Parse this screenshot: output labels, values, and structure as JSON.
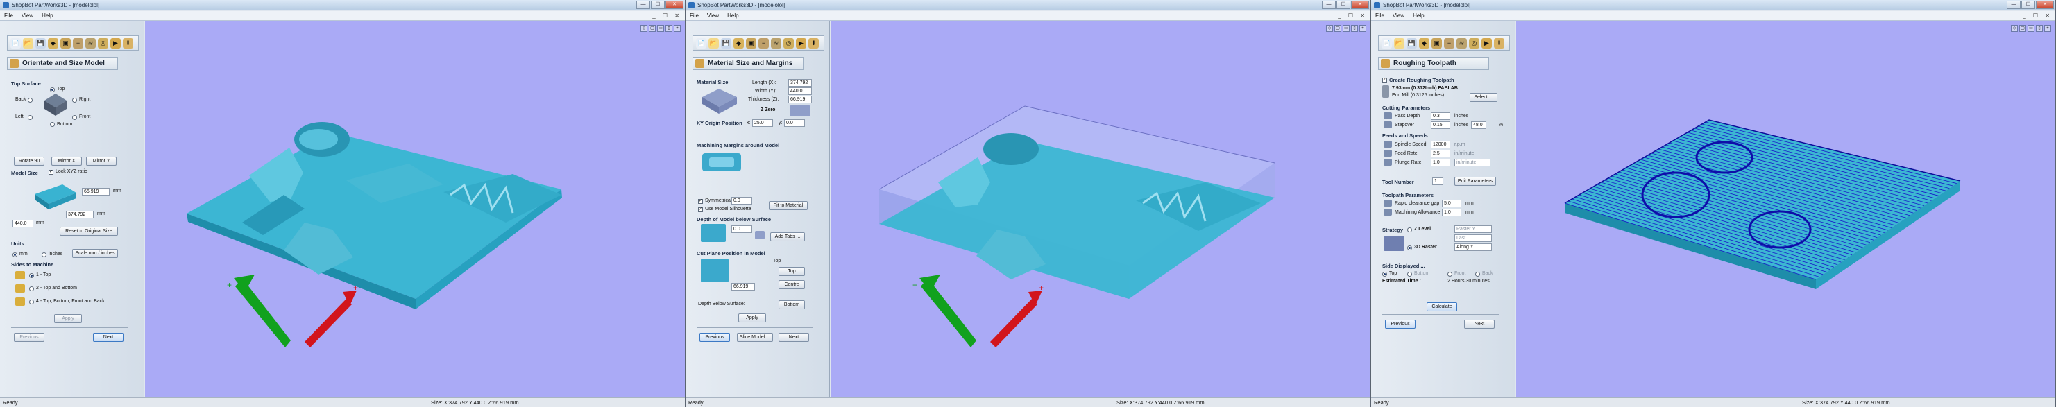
{
  "app_title": "ShopBot PartWorks3D - [modelolol]",
  "menu": [
    "File",
    "View",
    "Help"
  ],
  "status": {
    "ready": "Ready",
    "size": "Size: X:374.792 Y:440.0 Z:66.919 mm"
  },
  "colors": {
    "viewport_bg": "#aaaaf6",
    "model": "#39b3d1",
    "material_box": "#8fa0e3",
    "toolpath": "#1818c8",
    "x_arrow": "#d2151c",
    "y_arrow": "#11a11e"
  },
  "icons": [
    "new-icon",
    "open-icon",
    "save-icon",
    "orient-icon",
    "material-icon",
    "roughing-icon",
    "finishing-icon",
    "cutout-icon",
    "preview-icon",
    "save-toolpath-icon"
  ],
  "win1": {
    "panel_title": "Orientate and Size Model",
    "top_surface": {
      "header": "Top Surface",
      "top": "Top",
      "back": "Back",
      "right": "Right",
      "left": "Left",
      "front": "Front",
      "bottom": "Bottom"
    },
    "buttons": {
      "rotate": "Rotate 90",
      "mirror_x": "Mirror X",
      "mirror_y": "Mirror Y"
    },
    "model_size": {
      "header": "Model Size",
      "lock": "Lock XYZ ratio",
      "z": "66.919",
      "z_unit": "mm",
      "y": "374.792",
      "y_unit": "mm",
      "x": "440.0",
      "x_unit": "mm",
      "reset": "Reset to Original Size"
    },
    "units": {
      "header": "Units",
      "mm": "mm",
      "inches": "inches",
      "scale": "Scale mm / inches"
    },
    "sides": {
      "header": "Sides to Machine",
      "opt1": "1 - Top",
      "opt2": "2 - Top and Bottom",
      "opt4": "4 - Top, Bottom, Front and Back",
      "apply": "Apply"
    },
    "nav": {
      "previous": "Previous",
      "next": "Next"
    }
  },
  "win2": {
    "panel_title": "Material Size and Margins",
    "material": {
      "header": "Material Size",
      "length_label": "Length (X):",
      "length": "374.792",
      "width_label": "Width (Y):",
      "width": "440.0",
      "thickness_label": "Thickness (Z):",
      "thickness": "66.919",
      "zzero": "Z Zero"
    },
    "xy_origin": {
      "label": "XY Origin Position",
      "x_label": "x:",
      "x": "25.0",
      "y_label": "y:",
      "y": "0.0"
    },
    "margins": {
      "header": "Machining Margins around Model",
      "symmetrical": "Symmetrical",
      "sym_value": "0.0",
      "fit": "Fit to Material",
      "use_silhouette": "Use Model Silhouette"
    },
    "depth": {
      "header": "Depth of Model below Surface",
      "value": "0.0",
      "add_tabs": "Add Tabs ..."
    },
    "cut_plane": {
      "header": "Cut Plane Position in Model",
      "top": "Top",
      "centre": "Centre",
      "depth_label": "Depth Below Surface:",
      "depth": "66.919",
      "bottom": "Bottom",
      "apply": "Apply"
    },
    "nav": {
      "previous": "Previous",
      "slice": "Slice Model ...",
      "next": "Next"
    }
  },
  "win3": {
    "panel_title": "Roughing Toolpath",
    "create": "Create Roughing Toolpath",
    "tool": {
      "name": "7.93mm (0.312Inch) FABLAB",
      "desc": "End Mill (0.3125 inches)",
      "select": "Select ..."
    },
    "cutting": {
      "header": "Cutting Parameters",
      "pass_label": "Pass Depth",
      "pass": "0.3",
      "pass_unit": "inches",
      "stepover_label": "Stepover",
      "stepover": "0.15",
      "stepover_unit": "inches",
      "stepover_pct": "48.0",
      "pct": "%"
    },
    "feeds": {
      "header": "Feeds and Speeds",
      "spindle_label": "Spindle Speed",
      "spindle": "12000",
      "spindle_unit": "r.p.m",
      "feed_label": "Feed Rate",
      "feed": "2.5",
      "feed_unit": "in/minute",
      "plunge_label": "Plunge Rate",
      "plunge": "1.0",
      "plunge_unit": "in/minute"
    },
    "tool_number": {
      "label": "Tool Number",
      "value": "1",
      "edit": "Edit Parameters"
    },
    "params": {
      "header": "Toolpath Parameters",
      "rapid_label": "Rapid clearance gap",
      "rapid": "5.0",
      "rapid_unit": "mm",
      "allowance_label": "Machining Allowance",
      "allowance": "1.0",
      "allowance_unit": "mm"
    },
    "strategy": {
      "label": "Strategy",
      "zlevel": "Z Level",
      "zlevel_opt": "Raster Y",
      "last": "Last",
      "raster": "3D Raster",
      "raster_opt": "Along Y"
    },
    "side": {
      "header": "Side Displayed ...",
      "top": "Top",
      "bottom": "Bottom",
      "front": "Front",
      "back": "Back",
      "estimated_label": "Estimated Time :",
      "estimated": "2 Hours 30 minutes",
      "calculate": "Calculate"
    },
    "nav": {
      "previous": "Previous",
      "next": "Next"
    }
  }
}
